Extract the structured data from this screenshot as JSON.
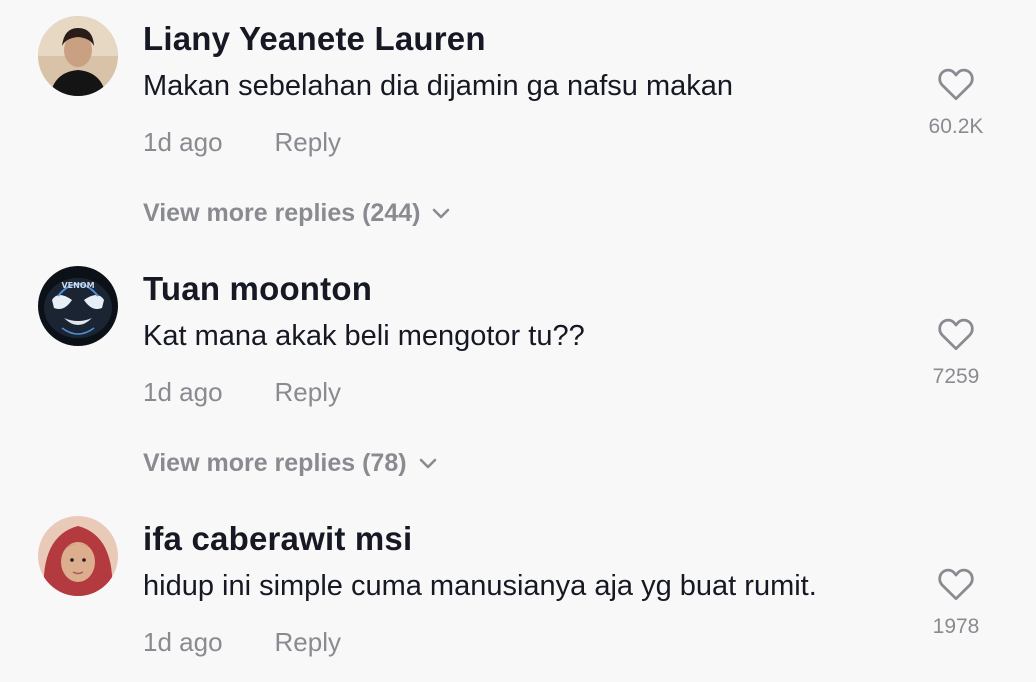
{
  "comments": [
    {
      "username": "Liany Yeanete Lauren",
      "text": "Makan sebelahan dia dijamin ga nafsu makan",
      "time": "1d ago",
      "reply_label": "Reply",
      "likes": "60.2K",
      "view_more": "View more replies (244)"
    },
    {
      "username": "Tuan moonton",
      "text": "Kat mana akak beli mengotor tu??",
      "time": "1d ago",
      "reply_label": "Reply",
      "likes": "7259",
      "view_more": "View more replies (78)"
    },
    {
      "username": "ifa caberawit msi",
      "text": "hidup ini simple cuma manusianya aja yg buat rumit.",
      "time": "1d ago",
      "reply_label": "Reply",
      "likes": "1978"
    }
  ],
  "icons": {
    "like": "heart-outline-icon",
    "expand": "chevron-down-icon"
  },
  "colors": {
    "background": "#f8f8f8",
    "primary_text": "#161823",
    "secondary_text": "#8a8b91"
  }
}
